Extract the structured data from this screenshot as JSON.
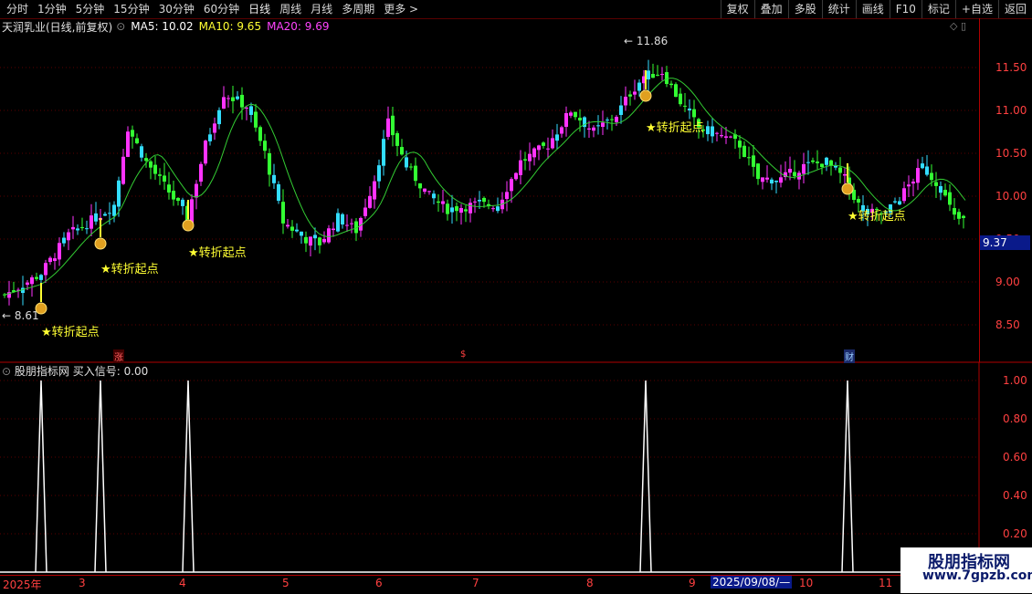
{
  "toolbar": {
    "periods": [
      "分时",
      "1分钟",
      "5分钟",
      "15分钟",
      "30分钟",
      "60分钟",
      "日线",
      "周线",
      "月线",
      "多周期",
      "更多 >"
    ],
    "active": "日线",
    "actions": [
      "复权",
      "叠加",
      "多股",
      "统计",
      "画线",
      "F10",
      "标记",
      "+自选",
      "返回"
    ]
  },
  "info": {
    "title": "天润乳业(日线,前复权)",
    "ma5": "MA5: 10.02",
    "ma10": "MA10: 9.65",
    "ma20": "MA20: 9.69"
  },
  "price_axis": {
    "labels": [
      "11.50",
      "11.00",
      "10.50",
      "10.00",
      "9.50",
      "9.00",
      "8.50"
    ],
    "current": "9.37",
    "high_mark": "11.86",
    "low_mark": "8.61"
  },
  "signals": {
    "label": "★转折起点",
    "items": 5
  },
  "events": {
    "zhang": "涨",
    "s": "$",
    "cai": "财"
  },
  "indicator": {
    "title": "股朋指标网",
    "name": "买入信号: 0.00",
    "axis": [
      "1.00",
      "0.80",
      "0.60",
      "0.40",
      "0.20"
    ],
    "spikes": 5
  },
  "dates": {
    "labels": [
      "2025年",
      "3",
      "4",
      "5",
      "6",
      "7",
      "8",
      "9",
      "10",
      "11"
    ],
    "cursor": "2025/09/08/—"
  },
  "watermark": {
    "cn": "股朋指标网",
    "url": "www.7gpzb.com"
  },
  "colors": {
    "up": "#ff33ff",
    "down": "#33ff33",
    "up_hollow": "#33ddff",
    "ma_green": "#33cc33",
    "ma_yellow": "#ffff33",
    "axis_red": "#ff4040",
    "grid_red": "#5a0000"
  }
}
